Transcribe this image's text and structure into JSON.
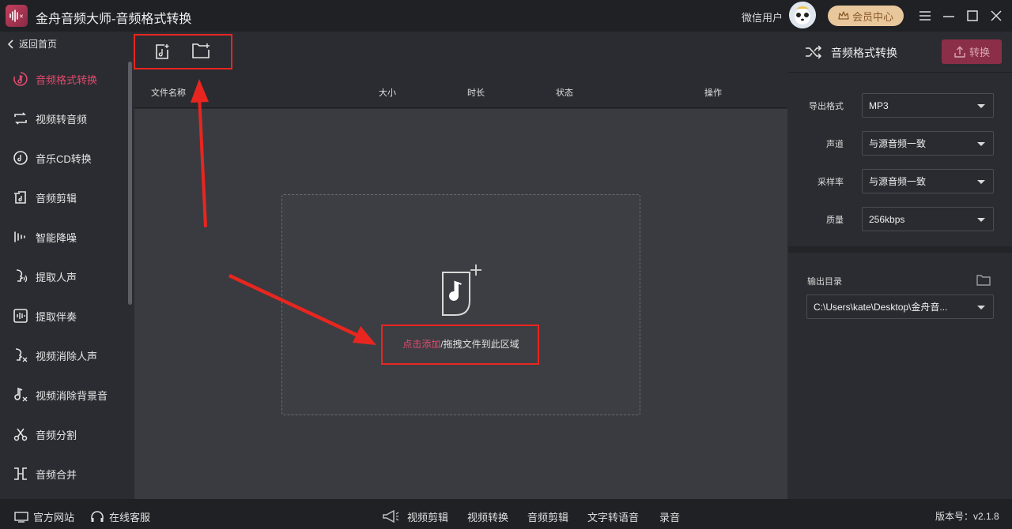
{
  "app": {
    "title": "金舟音频大师-音频格式转换"
  },
  "user": {
    "name": "微信用户"
  },
  "vip": {
    "label": "会员中心"
  },
  "sidebar": {
    "back_label": "返回首页",
    "items": [
      {
        "label": "音频格式转换",
        "icon": "music-convert-icon",
        "active": true
      },
      {
        "label": "视频转音频",
        "icon": "video-to-audio-icon"
      },
      {
        "label": "音乐CD转换",
        "icon": "cd-icon"
      },
      {
        "label": "音频剪辑",
        "icon": "audio-cut-icon"
      },
      {
        "label": "智能降噪",
        "icon": "noise-reduction-icon"
      },
      {
        "label": "提取人声",
        "icon": "voice-extract-icon"
      },
      {
        "label": "提取伴奏",
        "icon": "accompaniment-icon"
      },
      {
        "label": "视频消除人声",
        "icon": "remove-voice-icon"
      },
      {
        "label": "视频消除背景音",
        "icon": "remove-bgm-icon"
      },
      {
        "label": "音频分割",
        "icon": "split-icon"
      },
      {
        "label": "音频合并",
        "icon": "merge-icon"
      }
    ]
  },
  "table": {
    "columns": [
      "文件名称",
      "大小",
      "时长",
      "状态",
      "操作"
    ]
  },
  "dropzone": {
    "accent_text": "点击添加",
    "text": "/拖拽文件到此区域"
  },
  "panel": {
    "title": "音频格式转换",
    "convert_label": "转换",
    "fields": [
      {
        "label": "导出格式",
        "value": "MP3"
      },
      {
        "label": "声道",
        "value": "与源音频一致"
      },
      {
        "label": "采样率",
        "value": "与源音频一致"
      },
      {
        "label": "质量",
        "value": "256kbps"
      }
    ],
    "output_label": "输出目录",
    "output_path": "C:\\Users\\kate\\Desktop\\金舟音..."
  },
  "bottom": {
    "website": "官方网站",
    "support": "在线客服",
    "links": [
      "视频剪辑",
      "视频转换",
      "音频剪辑",
      "文字转语音",
      "录音"
    ],
    "version": "版本号：v2.1.8"
  },
  "colors": {
    "accent": "#e24a6e",
    "annotation": "#e8261f",
    "vip": "#e9c79c"
  }
}
